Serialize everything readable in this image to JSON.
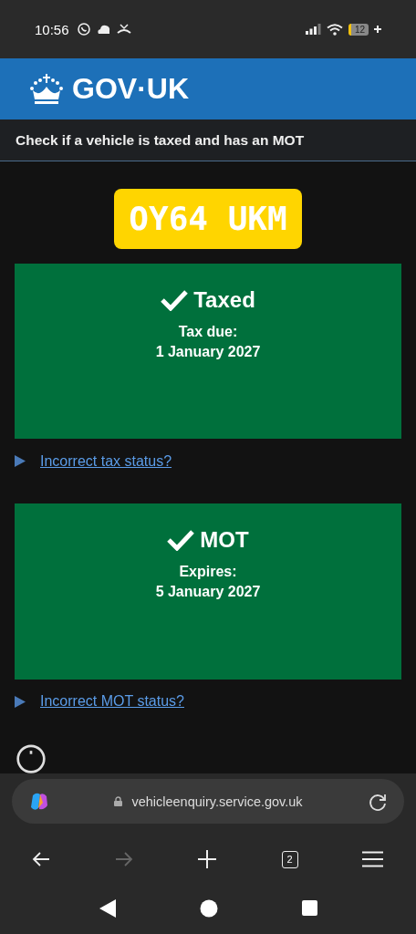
{
  "status_bar": {
    "time": "10:56",
    "battery": "12"
  },
  "header": {
    "logo": "GOV·UK"
  },
  "service_name": "Check if a vehicle is taxed and has an MOT",
  "registration": "OY64 UKM",
  "panels": [
    {
      "title": "Taxed",
      "ok": true,
      "label": "Tax due:",
      "date": "1 January 2027",
      "details": {
        "summary": "Incorrect tax status?",
        "expanded": false
      }
    },
    {
      "title": "MOT",
      "ok": true,
      "label": "Expires:",
      "date": "5 January 2027",
      "details": {
        "summary": "Incorrect MOT status?",
        "expanded": false
      }
    }
  ],
  "browser": {
    "url": "vehicleenquiry.service.gov.uk",
    "tab_count": "2"
  }
}
